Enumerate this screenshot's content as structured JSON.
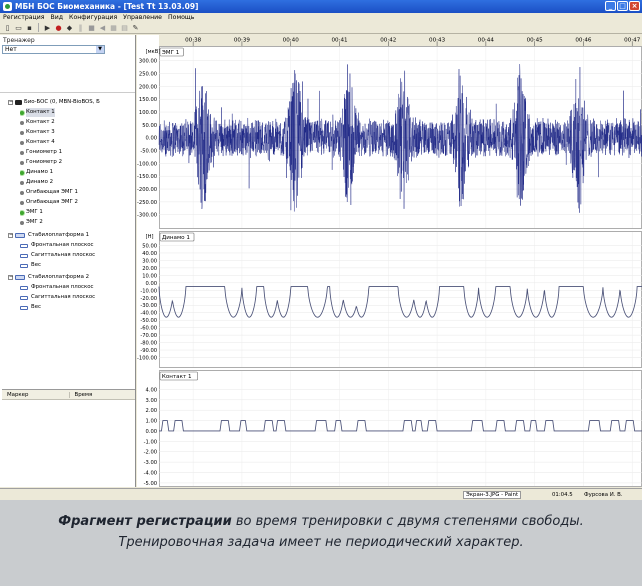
{
  "window": {
    "title": "МБН БОС Биомеханика - [Test Tt 13.03.09]"
  },
  "menu": [
    "Регистрация",
    "Вид",
    "Конфигурация",
    "Управление",
    "Помощь"
  ],
  "left_panel": {
    "label": "Тренажер",
    "combo_value": "Нет",
    "tree": [
      {
        "level": 0,
        "expander": "−",
        "kind": "device",
        "label": "Био-БОС (0, MBN-BioBOS, Б"
      },
      {
        "level": 1,
        "kind": "channel",
        "active": true,
        "label": "Контакт 1",
        "selected": true
      },
      {
        "level": 1,
        "kind": "channel",
        "active": false,
        "label": "Контакт 2"
      },
      {
        "level": 1,
        "kind": "channel",
        "active": false,
        "label": "Контакт 3"
      },
      {
        "level": 1,
        "kind": "channel",
        "active": false,
        "label": "Контакт 4"
      },
      {
        "level": 1,
        "kind": "channel",
        "active": false,
        "label": "Гониометр 1"
      },
      {
        "level": 1,
        "kind": "channel",
        "active": false,
        "label": "Гониометр 2"
      },
      {
        "level": 1,
        "kind": "channel",
        "active": true,
        "label": "Динамо 1"
      },
      {
        "level": 1,
        "kind": "channel",
        "active": false,
        "label": "Динамо 2"
      },
      {
        "level": 1,
        "kind": "channel",
        "active": false,
        "label": "Огибающая ЭМГ 1"
      },
      {
        "level": 1,
        "kind": "channel",
        "active": false,
        "label": "Огибающая ЭМГ 2"
      },
      {
        "level": 1,
        "kind": "channel",
        "active": true,
        "label": "ЭМГ 1"
      },
      {
        "level": 1,
        "kind": "channel",
        "active": false,
        "label": "ЭМГ 2"
      },
      {
        "level": 0,
        "expander": "−",
        "kind": "platform",
        "label": "Стабилоплатформа 1"
      },
      {
        "level": 1,
        "kind": "sensor",
        "label": "Фронтальная плоскос"
      },
      {
        "level": 1,
        "kind": "sensor",
        "label": "Сагиттальная плоскос"
      },
      {
        "level": 1,
        "kind": "sensor",
        "label": "Вес"
      },
      {
        "level": 0,
        "expander": "−",
        "kind": "platform",
        "label": "Стабилоплатформа 2"
      },
      {
        "level": 1,
        "kind": "sensor",
        "label": "Фронтальная плоскос"
      },
      {
        "level": 1,
        "kind": "sensor",
        "label": "Сагиттальная плоскос"
      },
      {
        "level": 1,
        "kind": "sensor",
        "label": "Вес"
      }
    ],
    "marker_table": {
      "columns": [
        "Маркер",
        "Время"
      ]
    }
  },
  "time_axis": {
    "labels": [
      "00:38",
      "00:39",
      "00:40",
      "00:41",
      "00:42",
      "00:43",
      "00:44",
      "00:45",
      "00:46",
      "00:47"
    ]
  },
  "chart_data": [
    {
      "type": "line",
      "title": "ЭМГ 1",
      "ylabel": "[мкВ]",
      "ylim": [
        -340,
        330
      ],
      "yticks": [
        "300.00",
        "250.00",
        "200.00",
        "150.00",
        "100.00",
        "50.00",
        "0.00",
        "-50.00",
        "-100.00",
        "-150.00",
        "-200.00",
        "-250.00",
        "-300.00"
      ],
      "ytick_values": [
        300,
        250,
        200,
        150,
        100,
        50,
        0,
        -50,
        -100,
        -150,
        -200,
        -250,
        -300
      ],
      "x_range_seconds": [
        37.3,
        47.2
      ],
      "series": [
        {
          "color": "#1c2585",
          "signal": "emg",
          "bursts_at_seconds": [
            38.2,
            40.1,
            41.2,
            42.3,
            43.5,
            44.7,
            45.9
          ]
        }
      ]
    },
    {
      "type": "line",
      "title": "Динамо 1",
      "ylabel": "[H]",
      "ylim": [
        -110,
        60
      ],
      "yticks": [
        "50.00",
        "40.00",
        "30.00",
        "20.00",
        "10.00",
        "0.00",
        "-10.00",
        "-20.00",
        "-30.00",
        "-40.00",
        "-50.00",
        "-60.00",
        "-70.00",
        "-80.00",
        "-90.00",
        "-100.00"
      ],
      "ytick_values": [
        50,
        40,
        30,
        20,
        10,
        0,
        -10,
        -20,
        -30,
        -40,
        -50,
        -60,
        -70,
        -80,
        -90,
        -100
      ],
      "x_range_seconds": [
        37.3,
        47.2
      ],
      "series": [
        {
          "color": "#4b5278",
          "baseline": -5,
          "dip_value": -46,
          "dips": [
            [
              37.3,
              37.6
            ],
            [
              37.55,
              37.85
            ],
            [
              38.65,
              39.0
            ],
            [
              39.0,
              39.3
            ],
            [
              39.45,
              39.75
            ],
            [
              39.7,
              40.0
            ],
            [
              40.35,
              40.75
            ],
            [
              40.8,
              41.1
            ],
            [
              41.05,
              41.4
            ],
            [
              41.3,
              41.6
            ],
            [
              42.2,
              42.55
            ],
            [
              42.5,
              42.8
            ],
            [
              42.75,
              43.05
            ],
            [
              43.55,
              43.85
            ],
            [
              43.85,
              44.2
            ],
            [
              44.5,
              44.85
            ],
            [
              44.85,
              45.2
            ],
            [
              45.2,
              45.5
            ],
            [
              46.0,
              46.4
            ],
            [
              46.4,
              46.75
            ],
            [
              46.75,
              47.1
            ]
          ]
        }
      ]
    },
    {
      "type": "line",
      "title": "Контакт 1",
      "ylim": [
        -5.2,
        5.0
      ],
      "yticks": [
        "4.00",
        "3.00",
        "2.00",
        "1.00",
        "0.00",
        "-1.00",
        "-2.00",
        "-3.00",
        "-4.00",
        "-5.00"
      ],
      "ytick_values": [
        4,
        3,
        2,
        1,
        0,
        -1,
        -2,
        -3,
        -4,
        -5
      ],
      "x_range_seconds": [
        37.3,
        47.2
      ],
      "series": [
        {
          "color": "#4b5278",
          "low": 0,
          "high": 1,
          "pulses": [
            [
              37.35,
              37.5
            ],
            [
              37.6,
              37.8
            ],
            [
              38.55,
              38.75
            ],
            [
              38.95,
              39.1
            ],
            [
              39.45,
              39.65
            ],
            [
              39.7,
              39.9
            ],
            [
              40.5,
              40.75
            ],
            [
              40.9,
              41.05
            ],
            [
              41.35,
              41.55
            ],
            [
              42.3,
              42.5
            ],
            [
              42.55,
              42.7
            ],
            [
              42.8,
              43.0
            ],
            [
              43.7,
              43.95
            ],
            [
              44.2,
              44.4
            ],
            [
              44.6,
              44.8
            ],
            [
              44.9,
              45.05
            ],
            [
              45.2,
              45.4
            ],
            [
              46.1,
              46.35
            ],
            [
              46.55,
              46.75
            ],
            [
              46.85,
              47.05
            ]
          ]
        }
      ]
    }
  ],
  "status": {
    "task": "Экран-3.JPG - Paint",
    "time": "01:04.5",
    "user": "Фурсова И. В."
  },
  "caption": {
    "bold": "Фрагмент регистрации",
    "line1_rest": " во время тренировки с двумя степенями свободы.",
    "line2": "Тренировочная задача имеет не периодический характер."
  }
}
